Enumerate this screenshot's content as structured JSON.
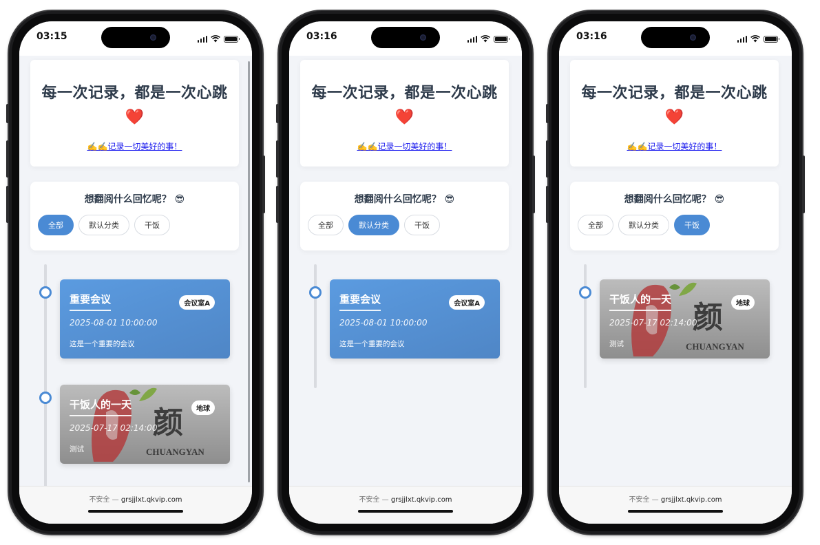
{
  "colors": {
    "accent": "#4a8ad4",
    "title_text": "#2d3a4a",
    "link": "#1a1aee",
    "heart": "#e0262b"
  },
  "phones": [
    {
      "time": "03:15",
      "hero": {
        "title": "每一次记录，都是一次心跳",
        "heart": "❤️",
        "link": "✍️✍️记录一切美好的事！"
      },
      "filter": {
        "title": "想翻阅什么回忆呢？ 😎",
        "chips": [
          "全部",
          "默认分类",
          "干饭"
        ],
        "active": 0
      },
      "entries": [
        {
          "title": "重要会议",
          "badge": "会议室A",
          "date": "2025-08-01 10:00:00",
          "desc": "这是一个重要的会议",
          "style": "blue"
        },
        {
          "title": "干饭人的一天",
          "badge": "地球",
          "date": "2025-07-17 02:14:00",
          "desc": "测试",
          "style": "gray",
          "art_text": "CHUANGYAN"
        }
      ],
      "scrollbar_visible": true,
      "url": {
        "insecure": "不安全 —",
        "domain": "grsjjlxt.qkvip.com"
      }
    },
    {
      "time": "03:16",
      "hero": {
        "title": "每一次记录，都是一次心跳",
        "heart": "❤️",
        "link": "✍️✍️记录一切美好的事！"
      },
      "filter": {
        "title": "想翻阅什么回忆呢？ 😎",
        "chips": [
          "全部",
          "默认分类",
          "干饭"
        ],
        "active": 1
      },
      "entries": [
        {
          "title": "重要会议",
          "badge": "会议室A",
          "date": "2025-08-01 10:00:00",
          "desc": "这是一个重要的会议",
          "style": "blue"
        }
      ],
      "scrollbar_visible": false,
      "url": {
        "insecure": "不安全 —",
        "domain": "grsjjlxt.qkvip.com"
      }
    },
    {
      "time": "03:16",
      "hero": {
        "title": "每一次记录，都是一次心跳",
        "heart": "❤️",
        "link": "✍️✍️记录一切美好的事！"
      },
      "filter": {
        "title": "想翻阅什么回忆呢？ 😎",
        "chips": [
          "全部",
          "默认分类",
          "干饭"
        ],
        "active": 2
      },
      "entries": [
        {
          "title": "干饭人的一天",
          "badge": "地球",
          "date": "2025-07-17 02:14:00",
          "desc": "测试",
          "style": "gray",
          "art_text": "CHUANGYAN"
        }
      ],
      "scrollbar_visible": false,
      "url": {
        "insecure": "不安全 —",
        "domain": "grsjjlxt.qkvip.com"
      }
    }
  ]
}
